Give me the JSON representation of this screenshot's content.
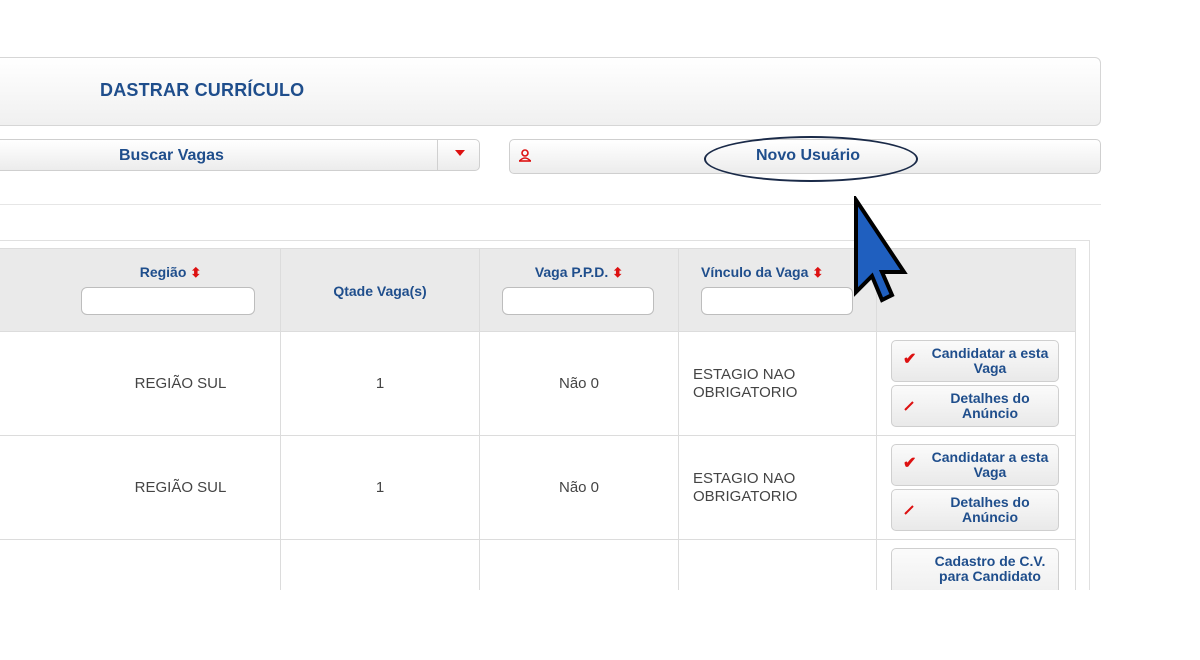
{
  "header": {
    "title": "DASTRAR CURRÍCULO"
  },
  "search": {
    "dropdown_label": "Buscar Vagas"
  },
  "user": {
    "new_user_label": "Novo Usuário"
  },
  "table": {
    "headers": [
      {
        "label": "Região",
        "sortable": true,
        "filter": true
      },
      {
        "label": "Qtade Vaga(s)",
        "sortable": false,
        "filter": false
      },
      {
        "label": "Vaga P.P.D.",
        "sortable": true,
        "filter": true
      },
      {
        "label": "Vínculo da Vaga",
        "sortable": true,
        "filter": true
      },
      {
        "label": "",
        "sortable": false,
        "filter": false
      }
    ],
    "rows": [
      {
        "regiao": "REGIÃO SUL",
        "qtade": "1",
        "ppd": "Não 0",
        "vinculo_1": "ESTAGIO NAO",
        "vinculo_2": "OBRIGATORIO",
        "action_1": "Candidatar a esta Vaga",
        "action_2": "Detalhes do Anúncio"
      },
      {
        "regiao": "REGIÃO SUL",
        "qtade": "1",
        "ppd": "Não 0",
        "vinculo_1": "ESTAGIO NAO",
        "vinculo_2": "OBRIGATORIO",
        "action_1": "Candidatar a esta Vaga",
        "action_2": "Detalhes do Anúncio"
      },
      {
        "regiao": "",
        "qtade": "",
        "ppd": "",
        "vinculo_1": "",
        "vinculo_2": "",
        "action_1": "Cadastro de C.V. para Candidato"
      }
    ]
  },
  "colors": {
    "brand": "#1f4e8c",
    "accent": "#dd1111",
    "cursor": "#1f5fbf"
  }
}
